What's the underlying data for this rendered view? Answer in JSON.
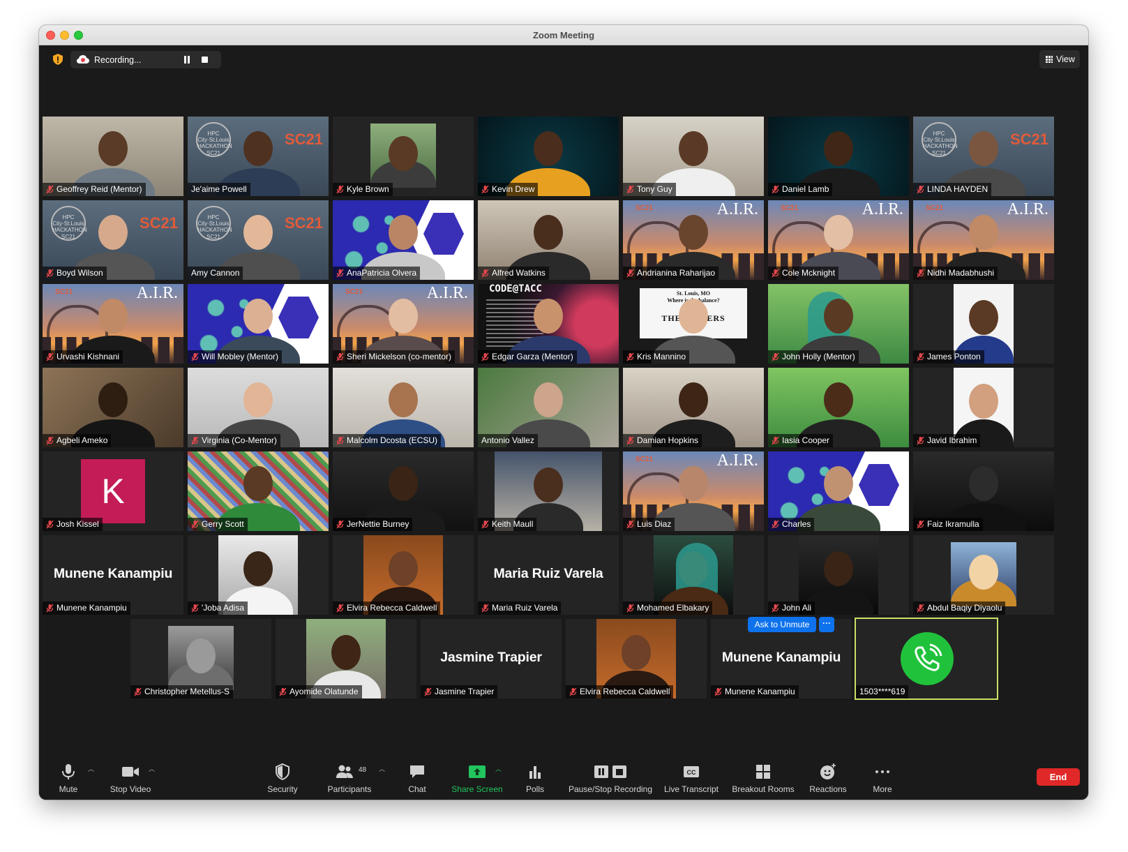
{
  "window": {
    "title": "Zoom Meeting"
  },
  "topbar": {
    "recording_label": "Recording...",
    "view_label": "View"
  },
  "gallery": {
    "ask_to_unmute": "Ask to Unmute",
    "more_dots": "···",
    "participants": [
      {
        "name": "Geoffrey Reid (Mentor)",
        "muted": true
      },
      {
        "name": "Je'aime Powell",
        "muted": false
      },
      {
        "name": "Kyle Brown",
        "muted": true
      },
      {
        "name": "Kevin Drew",
        "muted": true
      },
      {
        "name": "Tony Guy",
        "muted": true
      },
      {
        "name": "Daniel Lamb",
        "muted": true
      },
      {
        "name": "LINDA HAYDEN",
        "muted": true
      },
      {
        "name": "Boyd Wilson",
        "muted": true
      },
      {
        "name": "Amy Cannon",
        "muted": false
      },
      {
        "name": "AnaPatricia Olvera",
        "muted": true
      },
      {
        "name": "Alfred Watkins",
        "muted": true
      },
      {
        "name": "Andrianina Raharijao",
        "muted": true
      },
      {
        "name": "Cole Mcknight",
        "muted": true
      },
      {
        "name": "Nidhi Madabhushi",
        "muted": true
      },
      {
        "name": "Urvashi Kishnani",
        "muted": true
      },
      {
        "name": "Will Mobley (Mentor)",
        "muted": true
      },
      {
        "name": "Sheri Mickelson (co-mentor)",
        "muted": true
      },
      {
        "name": "Edgar Garza (Mentor)",
        "muted": true
      },
      {
        "name": "Kris Mannino",
        "muted": true
      },
      {
        "name": "John Holly (Mentor)",
        "muted": true
      },
      {
        "name": "James Ponton",
        "muted": true
      },
      {
        "name": "Agbeli Ameko",
        "muted": true
      },
      {
        "name": "Virginia (Co-Mentor)",
        "muted": true
      },
      {
        "name": "Malcolm Dcosta (ECSU)",
        "muted": true
      },
      {
        "name": "Antonio Vallez",
        "muted": false
      },
      {
        "name": "Damian Hopkins",
        "muted": true
      },
      {
        "name": "Iasia Cooper",
        "muted": true
      },
      {
        "name": "Javid Ibrahim",
        "muted": true
      },
      {
        "name": "Josh Kissel",
        "muted": true,
        "avatar_letter": "K"
      },
      {
        "name": "Gerry Scott",
        "muted": true
      },
      {
        "name": "JerNettie Burney",
        "muted": true
      },
      {
        "name": "Keith Maull",
        "muted": true
      },
      {
        "name": "Luis Diaz",
        "muted": true
      },
      {
        "name": "Charles",
        "muted": true
      },
      {
        "name": "Faiz Ikramulla",
        "muted": true
      },
      {
        "name": "Munene Kanampiu",
        "muted": true,
        "big_name": "Munene Kanampiu"
      },
      {
        "name": "'Joba Adisa",
        "muted": true
      },
      {
        "name": "Elvira Rebecca Caldwell",
        "muted": true
      },
      {
        "name": "Maria Ruiz Varela",
        "muted": true,
        "big_name": "Maria Ruiz Varela"
      },
      {
        "name": "Mohamed Elbakary",
        "muted": true
      },
      {
        "name": "John Ali",
        "muted": true
      },
      {
        "name": "Abdul Baqiy Diyaolu",
        "muted": true
      },
      {
        "name": "Christopher Metellus-S",
        "muted": true
      },
      {
        "name": "Ayomide Olatunde",
        "muted": true
      },
      {
        "name": "Jasmine Trapier",
        "muted": true,
        "big_name": "Jasmine Trapier"
      },
      {
        "name": "Elvira Rebecca Caldwell",
        "muted": true
      },
      {
        "name": "Munene Kanampiu",
        "muted": true,
        "big_name": "Munene Kanampiu"
      },
      {
        "name": "1503****619",
        "muted": false,
        "phone": true
      }
    ],
    "backgrounds": {
      "sc21": "SC21",
      "hpc_logo": "HPC City·St.Louis HACKATHON SC21",
      "air": "A.I.R.",
      "code_tacc": "CODE@TACC",
      "ff_line1": "St. Louis, MO",
      "ff_line2": "Where is the balance?",
      "ff_line3": "THE        ALIZERS"
    }
  },
  "toolbar": {
    "mute": "Mute",
    "stop_video": "Stop Video",
    "security": "Security",
    "participants": "Participants",
    "participants_count": "48",
    "chat": "Chat",
    "share_screen": "Share Screen",
    "polls": "Polls",
    "pause_stop_recording": "Pause/Stop Recording",
    "live_transcript": "Live Transcript",
    "breakout_rooms": "Breakout Rooms",
    "reactions": "Reactions",
    "more": "More",
    "end": "End",
    "cc_text": "CC"
  },
  "colors": {
    "window_bg": "#1a1a1a",
    "tile_bg": "#242424",
    "accent_blue": "#0e72ed",
    "end_red": "#e02828",
    "share_green": "#22c55e",
    "mute_red": "#e5484d",
    "active_speaker": "#c9e265"
  }
}
